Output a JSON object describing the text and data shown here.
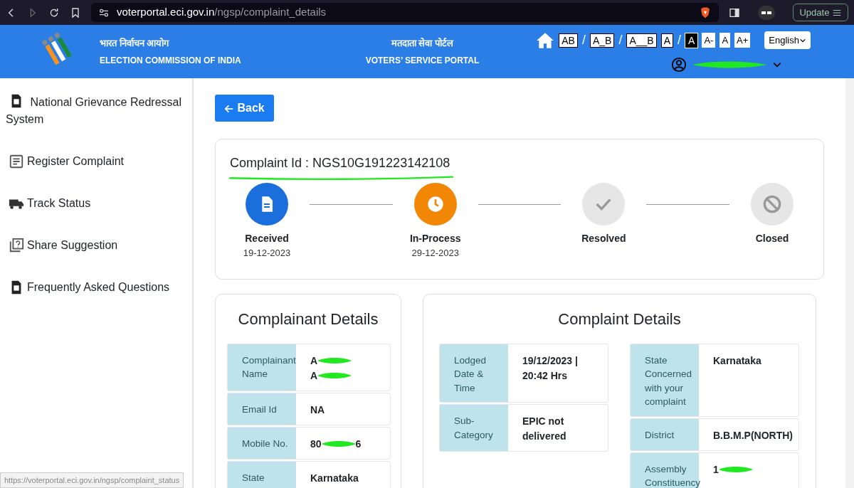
{
  "browser": {
    "url_host": "voterportal.eci.gov.in",
    "url_path": "/ngsp/complaint_details",
    "update_label": "Update"
  },
  "header": {
    "hindi_title": "भारत निर्वाचन आयोग",
    "title": "ELECTION COMMISSION OF INDIA",
    "portal_hindi": "मतदाता सेवा पोर्टल",
    "portal": "VOTERS’ SERVICE PORTAL",
    "toolbar": [
      {
        "kind": "spacing",
        "label": "AB"
      },
      {
        "kind": "separator",
        "label": "/"
      },
      {
        "kind": "spacing",
        "label": "A_B"
      },
      {
        "kind": "separator",
        "label": "/"
      },
      {
        "kind": "spacing",
        "label": "A__B"
      },
      {
        "kind": "contrast",
        "label": "A",
        "inverted": false
      },
      {
        "kind": "separator",
        "label": "/"
      },
      {
        "kind": "contrast",
        "label": "A",
        "inverted": true
      },
      {
        "kind": "size",
        "label": "A-"
      },
      {
        "kind": "size",
        "label": "A"
      },
      {
        "kind": "size",
        "label": "A+"
      }
    ],
    "language": "English",
    "user_redacted": true
  },
  "sidebar": {
    "items": [
      {
        "kind": "doc",
        "label": "National Grievance Redressal System"
      },
      {
        "kind": "form",
        "label": "Register Complaint"
      },
      {
        "kind": "truck",
        "label": "Track Status"
      },
      {
        "kind": "question",
        "label": "Share Suggestion"
      },
      {
        "kind": "doc",
        "label": "Frequently Asked Questions"
      }
    ]
  },
  "back_button": "Back",
  "status": {
    "complaint_id": "Complaint Id : NGS10G191223142108",
    "highlighted": true,
    "steps": [
      {
        "kind": "document",
        "label": "Received",
        "date": "19-12-2023",
        "color": "#1a6fdc"
      },
      {
        "kind": "clock",
        "label": "In-Process",
        "date": "29-12-2023",
        "color": "#f28705"
      },
      {
        "kind": "check",
        "label": "Resolved",
        "color": "#e6e6e6"
      },
      {
        "kind": "ban",
        "label": "Closed",
        "color": "#e6e6e6"
      }
    ]
  },
  "complainant": {
    "title": "Complainant Details",
    "rows": [
      {
        "label": "Complainant Name",
        "value_lines": [
          [
            {
              "kind": "text",
              "text": "A"
            },
            {
              "kind": "redaction"
            }
          ],
          [
            {
              "kind": "text",
              "text": "A"
            },
            {
              "kind": "redaction"
            }
          ]
        ]
      },
      {
        "label": "Email Id",
        "value_lines": [
          [
            {
              "kind": "text",
              "text": "NA"
            }
          ]
        ]
      },
      {
        "label": "Mobile No.",
        "value_lines": [
          [
            {
              "kind": "text",
              "text": "80"
            },
            {
              "kind": "redaction"
            },
            {
              "kind": "text",
              "text": "6"
            }
          ]
        ]
      },
      {
        "label": "State",
        "value_lines": [
          [
            {
              "kind": "text",
              "text": "Karnataka"
            }
          ]
        ]
      }
    ]
  },
  "complaint": {
    "title": "Complaint Details",
    "tables": [
      [
        {
          "label": "Lodged Date & Time",
          "value_lines": [
            [
              {
                "kind": "text",
                "text": "19/12/2023 | 20:42 Hrs"
              }
            ]
          ]
        },
        {
          "label": "Sub-Category",
          "value_lines": [
            [
              {
                "kind": "text",
                "text": "EPIC not delivered"
              }
            ]
          ]
        }
      ],
      [
        {
          "label": "State Concerned with your complaint",
          "value_lines": [
            [
              {
                "kind": "text",
                "text": "Karnataka"
              }
            ]
          ]
        },
        {
          "label": "District",
          "value_lines": [
            [
              {
                "kind": "text",
                "text": "B.B.M.P(NORTH)"
              }
            ]
          ]
        },
        {
          "label": "Assembly Constituency",
          "value_lines": [
            [
              {
                "kind": "text",
                "text": "1"
              },
              {
                "kind": "redaction"
              }
            ]
          ]
        }
      ]
    ]
  },
  "status_bar": "https://voterportal.eci.gov.in/ngsp/complaint_status"
}
